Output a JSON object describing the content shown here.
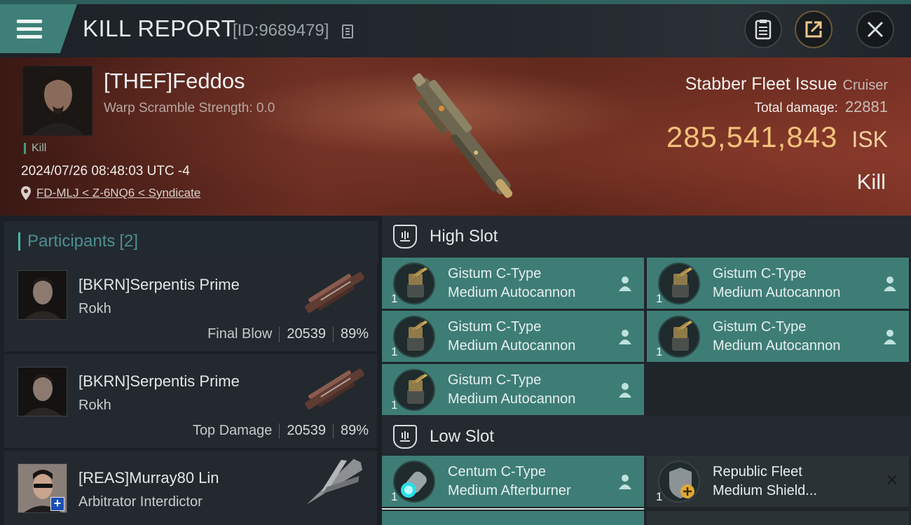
{
  "header": {
    "title": "KILL REPORT",
    "id_label": "[ID:9689479]",
    "menu_icon": "hamburger-icon",
    "buttons": [
      "clipboard-icon",
      "share-icon",
      "close-icon"
    ],
    "accent": "#3e7f78"
  },
  "victim": {
    "name": "[THEF]Feddos",
    "scram": "Warp Scramble Strength: 0.0",
    "kill_tag": "Kill",
    "datetime": "2024/07/26 08:48:03 UTC -4",
    "location": "FD-MLJ < Z-6NQ6 < Syndicate",
    "ship_name": "Stabber Fleet Issue",
    "ship_class": "Cruiser",
    "damage_label": "Total damage:",
    "damage_value": "22881",
    "isk_value": "285,541,843",
    "isk_unit": "ISK",
    "result": "Kill",
    "isk_color": "#f2c27a"
  },
  "participants": {
    "label": "Participants",
    "count": "[2]",
    "rows": [
      {
        "name": "[BKRN]Serpentis Prime",
        "ship": "Rokh",
        "tag": "Final Blow",
        "damage": "20539",
        "percent": "89%"
      },
      {
        "name": "[BKRN]Serpentis Prime",
        "ship": "Rokh",
        "tag": "Top Damage",
        "damage": "20539",
        "percent": "89%"
      },
      {
        "name": "[REAS]Murray80 Lin",
        "ship": "Arbitrator Interdictor"
      }
    ]
  },
  "fitting": {
    "high_slot": {
      "title": "High Slot",
      "modules": [
        {
          "qty": "1",
          "line1": "Gistum C-Type",
          "line2": "Medium Autocannon"
        },
        {
          "qty": "1",
          "line1": "Gistum C-Type",
          "line2": "Medium Autocannon"
        },
        {
          "qty": "1",
          "line1": "Gistum C-Type",
          "line2": "Medium Autocannon"
        },
        {
          "qty": "1",
          "line1": "Gistum C-Type",
          "line2": "Medium Autocannon"
        },
        {
          "qty": "1",
          "line1": "Gistum C-Type",
          "line2": "Medium Autocannon"
        }
      ]
    },
    "low_slot": {
      "title": "Low Slot",
      "modules": [
        {
          "qty": "1",
          "line1": "Centum C-Type",
          "line2": "Medium Afterburner"
        },
        {
          "qty": "1",
          "line1": "Republic Fleet",
          "line2": "Medium Shield...",
          "close": "✕"
        }
      ]
    }
  }
}
